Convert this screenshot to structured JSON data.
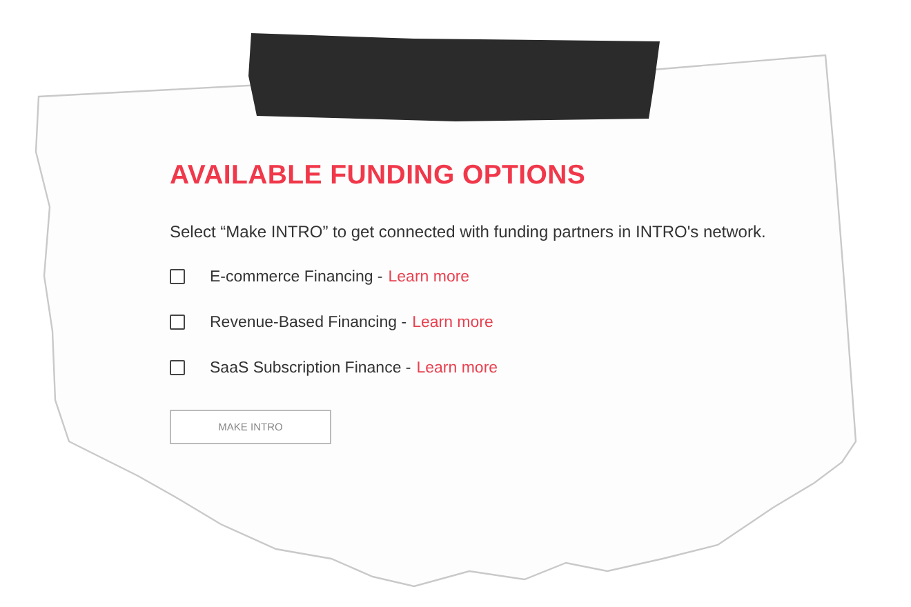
{
  "title": "AVAILABLE FUNDING OPTIONS",
  "intro": "Select “Make INTRO” to get connected with funding partners in INTRO's network.",
  "options": [
    {
      "label": "E-commerce Financing -",
      "link": "Learn more",
      "checked": false
    },
    {
      "label": "Revenue-Based Financing -",
      "link": "Learn more",
      "checked": false
    },
    {
      "label": "SaaS Subscription Finance -",
      "link": "Learn more",
      "checked": false
    }
  ],
  "button": "MAKE INTRO"
}
